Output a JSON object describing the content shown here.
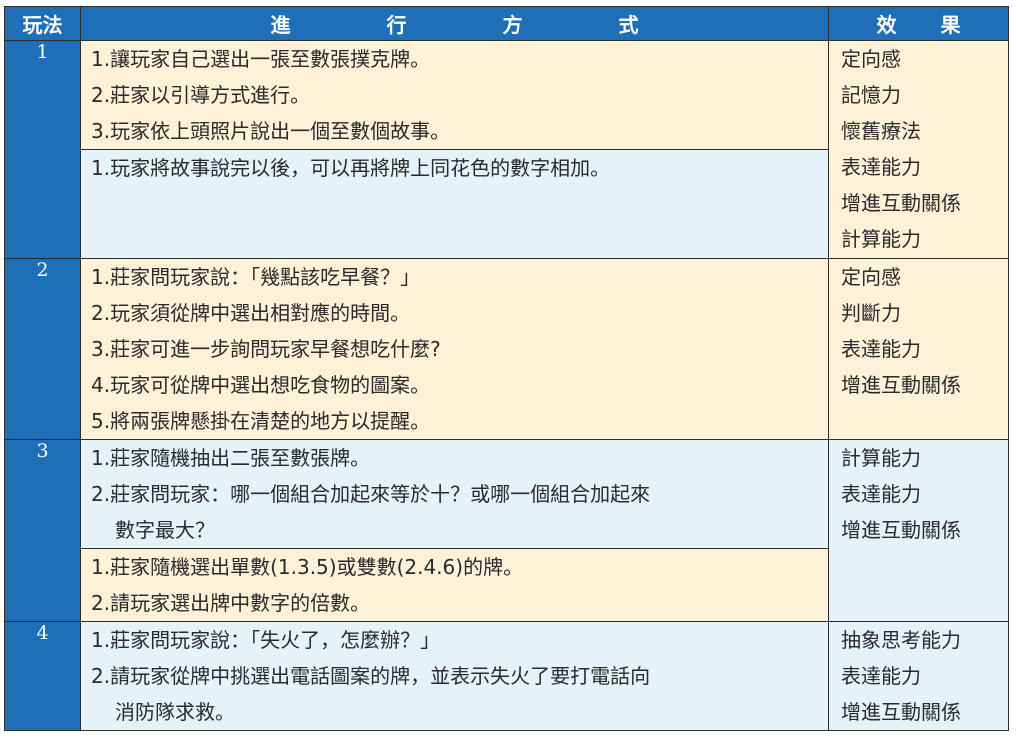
{
  "header": {
    "col_play": "玩法",
    "col_method_chars": [
      "進",
      "行",
      "方",
      "式"
    ],
    "col_effect_chars": [
      "效",
      "果"
    ]
  },
  "rows": [
    {
      "number": "1",
      "groups": [
        [
          "1.讓玩家自己選出一張至數張撲克牌。",
          "2.莊家以引導方式進行。",
          "3.玩家依上頭照片說出一個至數個故事。"
        ],
        [
          "1.玩家將故事說完以後，可以再將牌上同花色的數字相加。"
        ]
      ],
      "effects": [
        "定向感",
        "記憶力",
        "懷舊療法",
        "表達能力",
        "增進互動關係",
        "計算能力"
      ]
    },
    {
      "number": "2",
      "groups": [
        [
          "1.莊家問玩家說：「幾點該吃早餐？」",
          "2.玩家須從牌中選出相對應的時間。",
          "3.莊家可進一步詢問玩家早餐想吃什麼?",
          "4.玩家可從牌中選出想吃食物的圖案。",
          "5.將兩張牌懸掛在清楚的地方以提醒。"
        ]
      ],
      "effects": [
        "定向感",
        "判斷力",
        "表達能力",
        "增進互動關係"
      ]
    },
    {
      "number": "3",
      "groups": [
        [
          "1.莊家隨機抽出二張至數張牌。",
          "2.莊家問玩家：哪一個組合加起來等於十？或哪一個組合加起來",
          "數字最大？"
        ],
        [
          "1.莊家隨機選出單數(1.3.5)或雙數(2.4.6)的牌。",
          "2.請玩家選出牌中數字的倍數。"
        ]
      ],
      "effects": [
        "計算能力",
        "表達能力",
        "增進互動關係"
      ]
    },
    {
      "number": "4",
      "groups": [
        [
          "1.莊家問玩家說：「失火了，怎麼辦？」",
          "2.請玩家從牌中挑選出電話圖案的牌，並表示失火了要打電話向",
          "消防隊求救。"
        ]
      ],
      "effects": [
        "抽象思考能力",
        "表達能力",
        "增進互動關係"
      ]
    }
  ]
}
